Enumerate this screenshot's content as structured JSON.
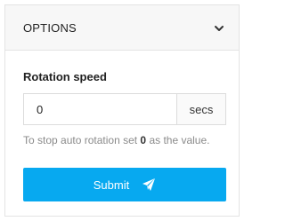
{
  "panel": {
    "title": "OPTIONS",
    "toggle_icon": "chevron-down-icon"
  },
  "form": {
    "field_label": "Rotation speed",
    "speed_value": "0",
    "unit": "secs",
    "help_prefix": "To stop auto rotation set ",
    "help_value": "0",
    "help_suffix": " as the value.",
    "submit_label": "Submit",
    "submit_icon": "send-icon"
  },
  "colors": {
    "accent": "#07a9f0",
    "header_bg": "#f7f7f7",
    "border": "#e3e3e3",
    "help_text": "#8a8a8a"
  }
}
